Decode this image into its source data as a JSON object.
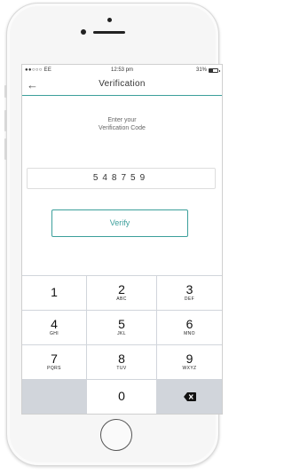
{
  "status_bar": {
    "carrier": "●●○○○ EE",
    "time": "12:53 pm",
    "battery": "31%",
    "wifi_icon": "wifi-icon",
    "battery_icon": "battery-icon"
  },
  "nav": {
    "back_icon": "arrow-left-icon",
    "back_glyph": "←",
    "title": "Verification"
  },
  "prompt": {
    "line1": "Enter your",
    "line2": "Verification Code"
  },
  "code_field": {
    "value": "548759"
  },
  "verify_button": {
    "label": "Verify"
  },
  "keypad": {
    "keys": [
      {
        "digit": "1",
        "letters": ""
      },
      {
        "digit": "2",
        "letters": "ABC"
      },
      {
        "digit": "3",
        "letters": "DEF"
      },
      {
        "digit": "4",
        "letters": "GHI"
      },
      {
        "digit": "5",
        "letters": "JKL"
      },
      {
        "digit": "6",
        "letters": "MNO"
      },
      {
        "digit": "7",
        "letters": "PQRS"
      },
      {
        "digit": "8",
        "letters": "TUV"
      },
      {
        "digit": "9",
        "letters": "WXYZ"
      },
      {
        "digit": "0",
        "letters": ""
      }
    ],
    "backspace_icon": "backspace-icon"
  },
  "colors": {
    "accent": "#3c9f9b",
    "keypad_bg": "#d1d5db",
    "text": "#333333"
  }
}
